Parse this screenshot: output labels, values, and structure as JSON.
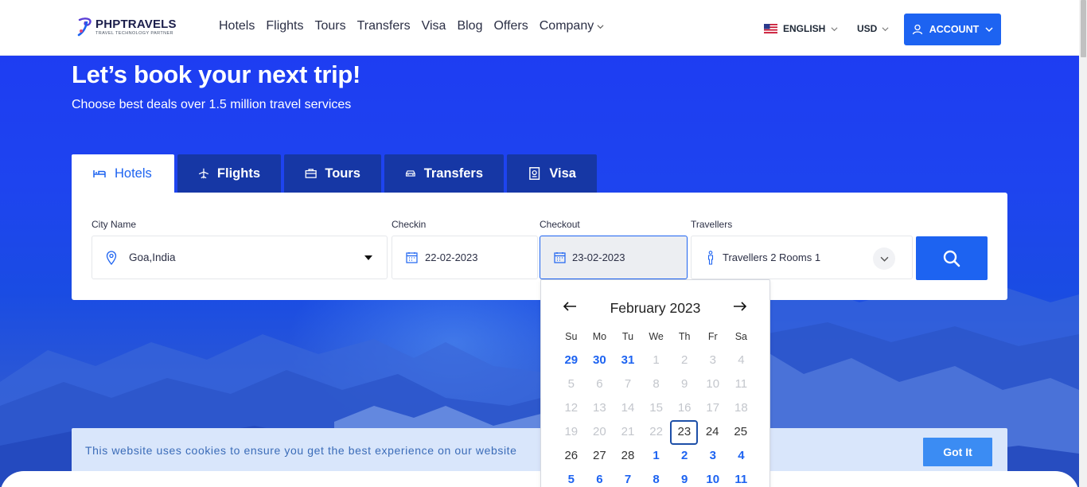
{
  "header": {
    "logo_name": "PHPTRAVELS",
    "logo_tagline": "TRAVEL TECHNOLOGY PARTNER",
    "nav": [
      "Hotels",
      "Flights",
      "Tours",
      "Transfers",
      "Visa",
      "Blog",
      "Offers",
      "Company"
    ],
    "language": "ENGLISH",
    "currency": "USD",
    "account_label": "ACCOUNT"
  },
  "hero": {
    "title": "Let’s book your next trip!",
    "subtitle": "Choose best deals over 1.5 million travel services"
  },
  "tabs": [
    {
      "label": "Hotels",
      "icon": "bed-icon",
      "active": true
    },
    {
      "label": "Flights",
      "icon": "plane-icon"
    },
    {
      "label": "Tours",
      "icon": "briefcase-icon"
    },
    {
      "label": "Transfers",
      "icon": "car-icon"
    },
    {
      "label": "Visa",
      "icon": "passport-icon"
    }
  ],
  "search": {
    "city_label": "City Name",
    "city_value": "Goa,India",
    "checkin_label": "Checkin",
    "checkin_value": "22-02-2023",
    "checkout_label": "Checkout",
    "checkout_value": "23-02-2023",
    "travellers_label": "Travellers",
    "travellers_value": "Travellers 2 Rooms 1"
  },
  "calendar": {
    "month": "February 2023",
    "weekdays": [
      "Su",
      "Mo",
      "Tu",
      "We",
      "Th",
      "Fr",
      "Sa"
    ],
    "weeks": [
      [
        {
          "d": "29",
          "t": "prev"
        },
        {
          "d": "30",
          "t": "prev"
        },
        {
          "d": "31",
          "t": "prev"
        },
        {
          "d": "1",
          "t": "disabled"
        },
        {
          "d": "2",
          "t": "disabled"
        },
        {
          "d": "3",
          "t": "disabled"
        },
        {
          "d": "4",
          "t": "disabled"
        }
      ],
      [
        {
          "d": "5",
          "t": "disabled"
        },
        {
          "d": "6",
          "t": "disabled"
        },
        {
          "d": "7",
          "t": "disabled"
        },
        {
          "d": "8",
          "t": "disabled"
        },
        {
          "d": "9",
          "t": "disabled"
        },
        {
          "d": "10",
          "t": "disabled"
        },
        {
          "d": "11",
          "t": "disabled"
        }
      ],
      [
        {
          "d": "12",
          "t": "disabled"
        },
        {
          "d": "13",
          "t": "disabled"
        },
        {
          "d": "14",
          "t": "disabled"
        },
        {
          "d": "15",
          "t": "disabled"
        },
        {
          "d": "16",
          "t": "disabled"
        },
        {
          "d": "17",
          "t": "disabled"
        },
        {
          "d": "18",
          "t": "disabled"
        }
      ],
      [
        {
          "d": "19",
          "t": "disabled"
        },
        {
          "d": "20",
          "t": "disabled"
        },
        {
          "d": "21",
          "t": "disabled"
        },
        {
          "d": "22",
          "t": "disabled"
        },
        {
          "d": "23",
          "t": "selected"
        },
        {
          "d": "24",
          "t": "day"
        },
        {
          "d": "25",
          "t": "day"
        }
      ],
      [
        {
          "d": "26",
          "t": "day"
        },
        {
          "d": "27",
          "t": "day"
        },
        {
          "d": "28",
          "t": "day"
        },
        {
          "d": "1",
          "t": "next"
        },
        {
          "d": "2",
          "t": "next"
        },
        {
          "d": "3",
          "t": "next"
        },
        {
          "d": "4",
          "t": "next"
        }
      ],
      [
        {
          "d": "5",
          "t": "next"
        },
        {
          "d": "6",
          "t": "next"
        },
        {
          "d": "7",
          "t": "next"
        },
        {
          "d": "8",
          "t": "next"
        },
        {
          "d": "9",
          "t": "next"
        },
        {
          "d": "10",
          "t": "next"
        },
        {
          "d": "11",
          "t": "next"
        }
      ]
    ]
  },
  "cookie": {
    "text": "This website uses cookies to ensure you get the best experience on our website",
    "button": "Got It"
  },
  "colors": {
    "primary": "#1d63f1",
    "tab_inactive": "#1637a5",
    "hero_top": "#1e3df2",
    "cookie_bg": "#d9e6fb"
  }
}
